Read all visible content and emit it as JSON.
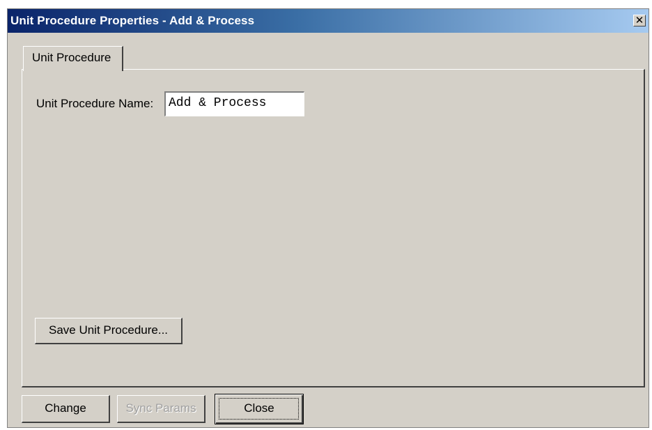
{
  "window": {
    "title": "Unit Procedure Properties - Add & Process",
    "close_glyph": "✕"
  },
  "tabs": [
    {
      "label": "Unit Procedure",
      "selected": true
    }
  ],
  "form": {
    "name_label": "Unit Procedure Name:",
    "name_value": "Add & Process"
  },
  "buttons": {
    "save_label": "Save Unit Procedure...",
    "change_label": "Change",
    "sync_label": "Sync Params",
    "sync_enabled": false,
    "close_label": "Close"
  },
  "colors": {
    "face": "#d4d0c8",
    "title_start": "#0a246a",
    "title_end": "#a6caf0"
  }
}
